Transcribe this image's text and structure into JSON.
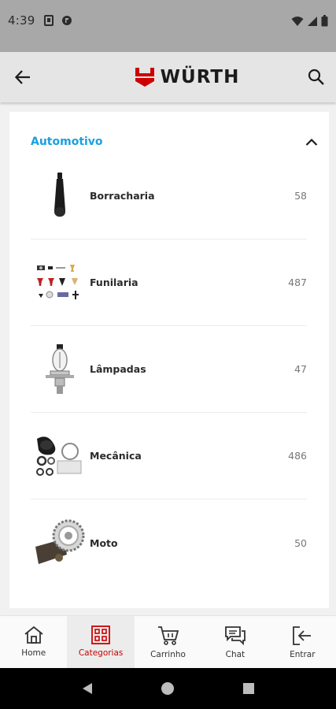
{
  "status": {
    "time": "4:39"
  },
  "app_bar": {
    "logo_text": "WÜRTH"
  },
  "section": {
    "title": "Automotivo"
  },
  "categories": [
    {
      "name": "Borracharia",
      "count": "58",
      "icon": "tire-valve-icon"
    },
    {
      "name": "Funilaria",
      "count": "487",
      "icon": "clips-icon"
    },
    {
      "name": "Lâmpadas",
      "count": "47",
      "icon": "headlight-bulb-icon"
    },
    {
      "name": "Mecânica",
      "count": "486",
      "icon": "cv-boot-kit-icon"
    },
    {
      "name": "Moto",
      "count": "50",
      "icon": "sprocket-chain-icon"
    }
  ],
  "bottom_nav": [
    {
      "label": "Home",
      "icon": "home-icon"
    },
    {
      "label": "Categorias",
      "icon": "grid-icon",
      "active": true
    },
    {
      "label": "Carrinho",
      "icon": "cart-icon"
    },
    {
      "label": "Chat",
      "icon": "chat-icon"
    },
    {
      "label": "Entrar",
      "icon": "login-icon"
    }
  ],
  "colors": {
    "accent": "#1aa0e0",
    "brand": "#cc0000",
    "active_nav": "#cc0000"
  }
}
